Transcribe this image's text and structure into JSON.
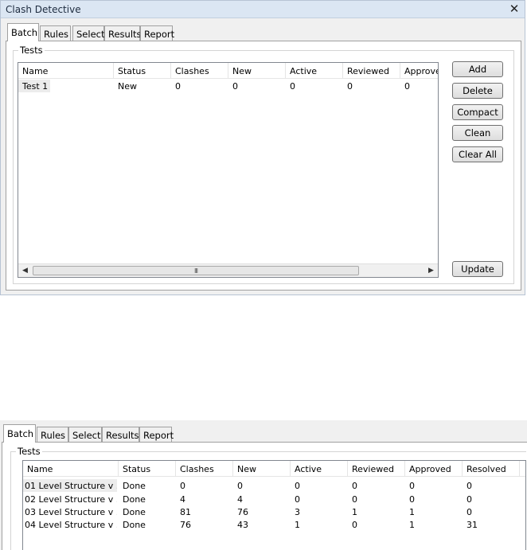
{
  "window": {
    "title": "Clash Detective",
    "close_glyph": "✕"
  },
  "tabs": [
    {
      "label": "Batch",
      "active": true
    },
    {
      "label": "Rules",
      "active": false
    },
    {
      "label": "Select",
      "active": false
    },
    {
      "label": "Results",
      "active": false
    },
    {
      "label": "Report",
      "active": false
    }
  ],
  "tests_group_label": "Tests",
  "columns": [
    "Name",
    "Status",
    "Clashes",
    "New",
    "Active",
    "Reviewed",
    "Approved",
    "Resolved"
  ],
  "top_rows": [
    {
      "name": "Test 1",
      "status": "New",
      "clashes": "0",
      "new": "0",
      "active": "0",
      "reviewed": "0",
      "approved": "0"
    }
  ],
  "buttons": {
    "add": "Add",
    "delete": "Delete",
    "compact": "Compact",
    "clean": "Clean",
    "clear_all": "Clear All",
    "update": "Update"
  },
  "scroll_grip": "III",
  "bottom_rows": [
    {
      "name": "01 Level Structure v ...",
      "status": "Done",
      "clashes": "0",
      "new": "0",
      "active": "0",
      "reviewed": "0",
      "approved": "0",
      "resolved": "0"
    },
    {
      "name": "02 Level Structure v ...",
      "status": "Done",
      "clashes": "4",
      "new": "4",
      "active": "0",
      "reviewed": "0",
      "approved": "0",
      "resolved": "0"
    },
    {
      "name": "03 Level Structure v ...",
      "status": "Done",
      "clashes": "81",
      "new": "76",
      "active": "3",
      "reviewed": "1",
      "approved": "1",
      "resolved": "0"
    },
    {
      "name": "04 Level Structure v ...",
      "status": "Done",
      "clashes": "76",
      "new": "43",
      "active": "1",
      "reviewed": "0",
      "approved": "1",
      "resolved": "31"
    }
  ]
}
